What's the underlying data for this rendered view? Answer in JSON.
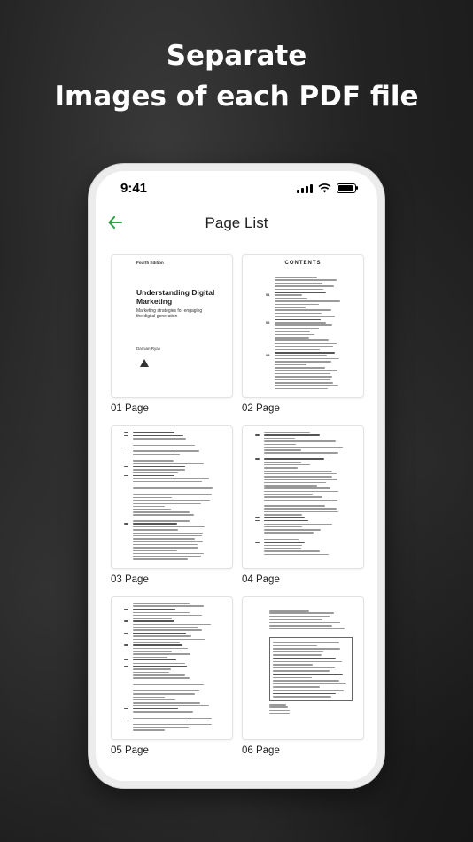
{
  "headline": {
    "line1": "Separate",
    "line2": "Images of each PDF file"
  },
  "status_bar": {
    "time": "9:41",
    "icons": [
      "signal-icon",
      "wifi-icon",
      "battery-icon"
    ]
  },
  "nav": {
    "title": "Page List",
    "back_icon": "arrow-left-icon",
    "accent_color": "#2f9e44"
  },
  "pages": [
    {
      "label": "01 Page"
    },
    {
      "label": "02 Page"
    },
    {
      "label": "03 Page"
    },
    {
      "label": "04 Page"
    },
    {
      "label": "05 Page"
    },
    {
      "label": "06 Page"
    }
  ],
  "cover": {
    "edition": "Fourth Edition",
    "title": "Understanding Digital Marketing",
    "subtitle": "Marketing strategies for engaging the digital generation",
    "author": "Damian Ryan"
  },
  "toc": {
    "heading": "CONTENTS",
    "chapter_numbers": [
      "01",
      "02",
      "03"
    ]
  }
}
